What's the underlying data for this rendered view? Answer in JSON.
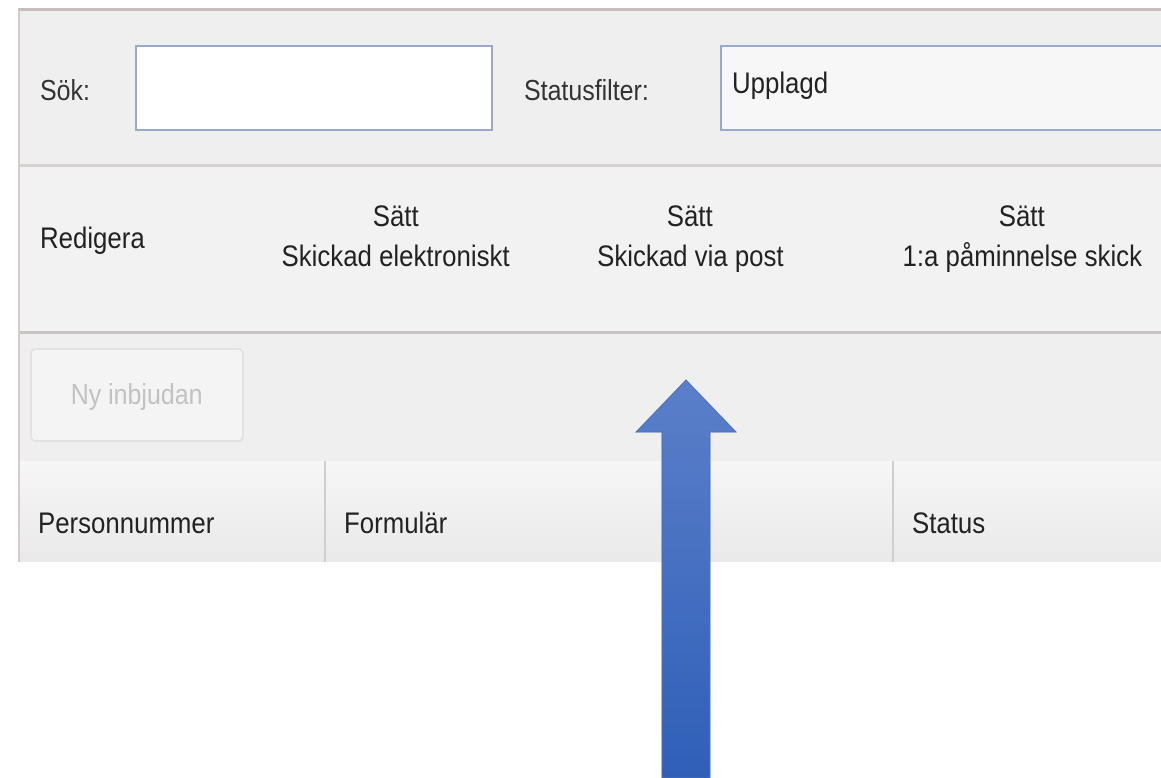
{
  "filter": {
    "search_label": "Sök:",
    "search_value": "",
    "status_label": "Statusfilter:",
    "status_value": "Upplagd"
  },
  "actions": [
    {
      "line1": "",
      "line2": "Redigera"
    },
    {
      "line1": "Sätt",
      "line2": "Skickad elektroniskt"
    },
    {
      "line1": "Sätt",
      "line2": "Skickad via post"
    },
    {
      "line1": "Sätt",
      "line2": "1:a påminnelse skick"
    }
  ],
  "toolbar": {
    "new_invitation_label": "Ny inbjudan"
  },
  "table": {
    "columns": [
      "Personnummer",
      "Formulär",
      "Status"
    ]
  },
  "colors": {
    "arrow_top": "#5b7fc9",
    "arrow_bottom": "#2f5fb8"
  },
  "icons": {
    "annotation": "up-arrow-icon"
  }
}
